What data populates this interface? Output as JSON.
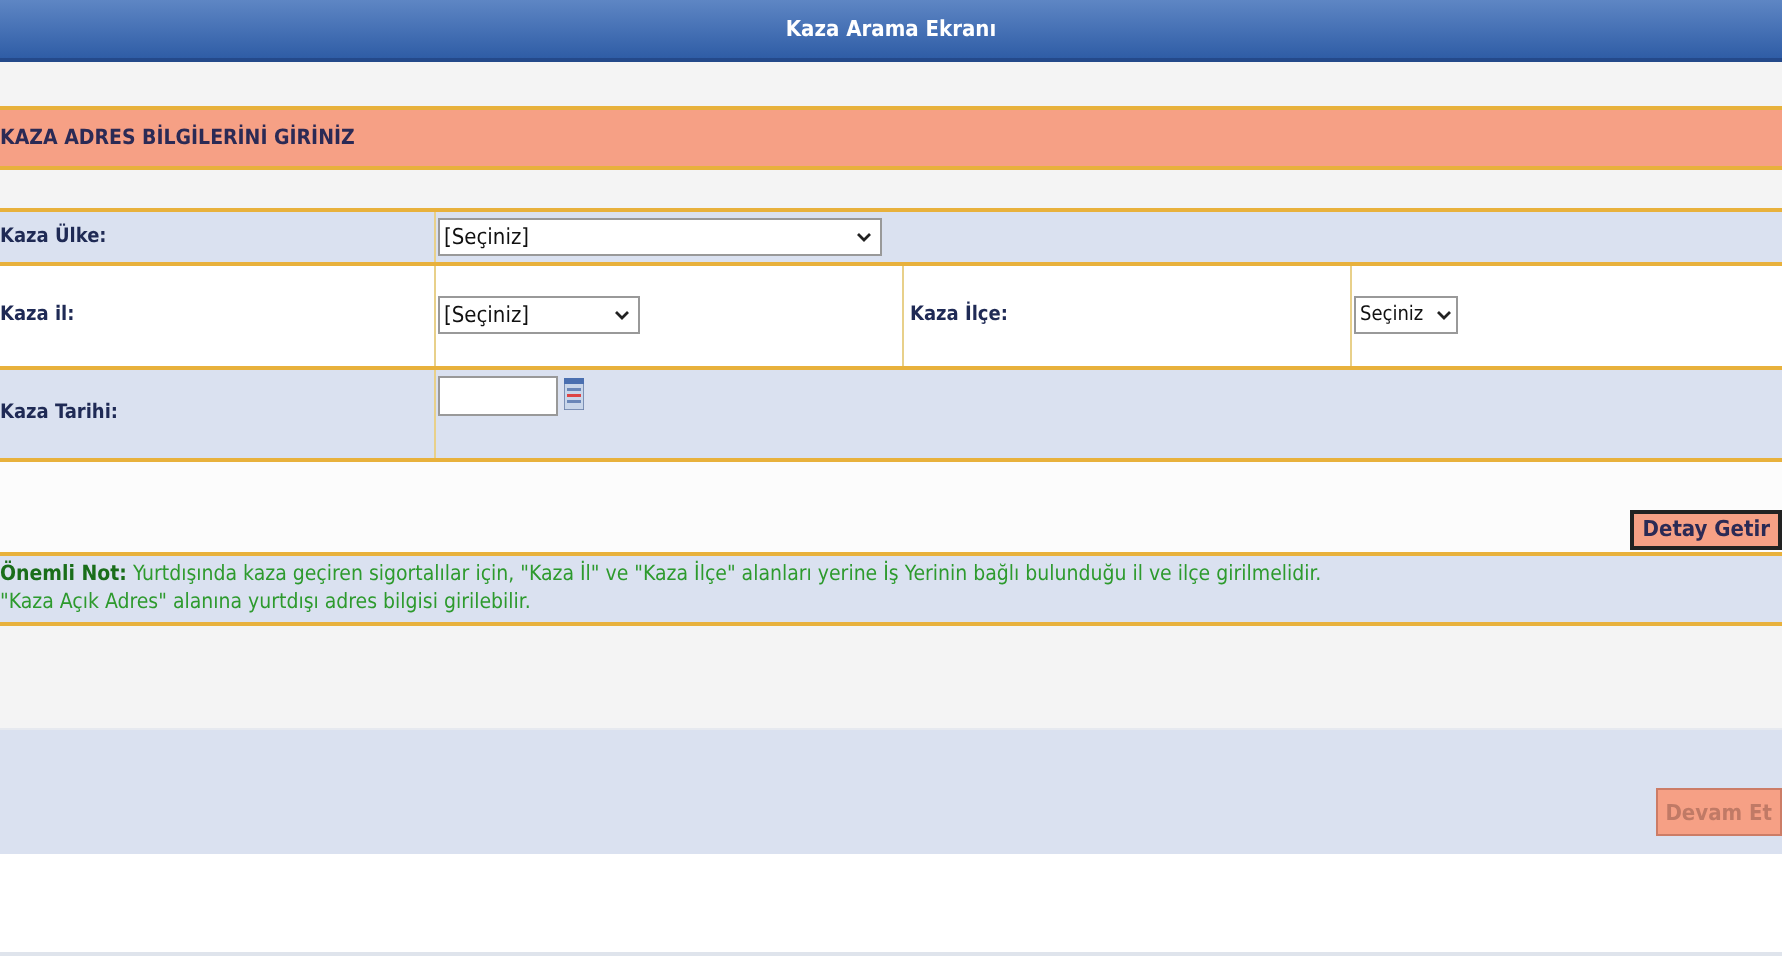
{
  "window": {
    "title": "Kaza Arama Ekranı"
  },
  "section": {
    "title": "KAZA ADRES BİLGİLERİNİ GİRİNİZ"
  },
  "fields": {
    "country": {
      "label": "Kaza Ülke:",
      "value": "[Seçiniz]"
    },
    "province": {
      "label": "Kaza il:",
      "value": "[Seçiniz]"
    },
    "district": {
      "label": "Kaza İlçe:",
      "value": "Seçiniz"
    },
    "date": {
      "label": "Kaza Tarihi:"
    }
  },
  "detail_button": {
    "label": "Detay Getir",
    "disabled": false
  },
  "note": {
    "lines": [
      "**Önemli Not:** Yurtdışında kaza geçiren sigortalılar için, \"Kaza İl\" ve \"Kaza İlçe\" alanları yerine İş Yerinin bağlı bulunduğu il ve ilçe girilmelidir.",
      "\"Kaza Açık Adres\" alanına yurtdışı adres bilgisi girilebilir."
    ]
  },
  "continue_button": {
    "label": "Devam Et",
    "disabled": true
  }
}
